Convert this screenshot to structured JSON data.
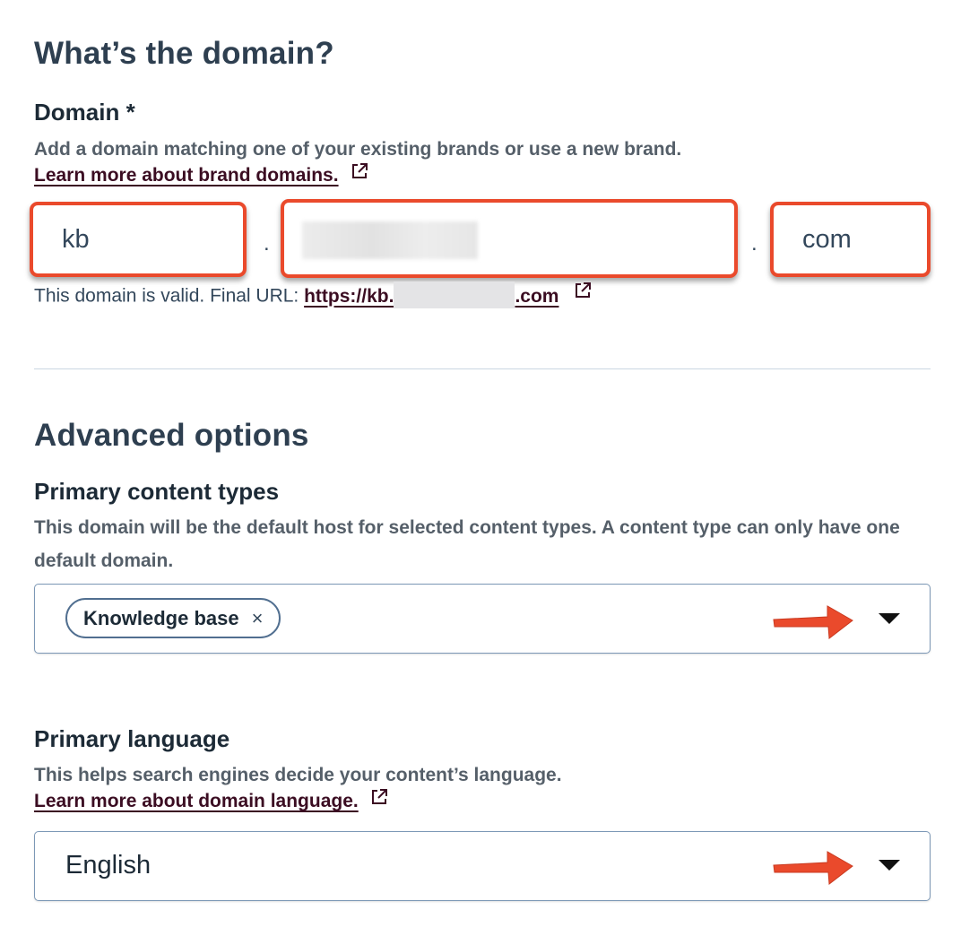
{
  "domain_section": {
    "title": "What’s the domain?",
    "label": "Domain *",
    "help": "Add a domain matching one of your existing brands or use a new brand.",
    "link": "Learn more about brand domains.",
    "subdomain_value": "kb",
    "top_level_value": "com",
    "separator": ".",
    "valid_text": "This domain is valid. Final URL: ",
    "final_url_prefix": "https://kb.",
    "final_url_suffix": ".com"
  },
  "advanced": {
    "title": "Advanced options",
    "content_types": {
      "label": "Primary content types",
      "help": "This domain will be the default host for selected content types. A content type can only have one default domain.",
      "selected_tag": "Knowledge base",
      "remove_glyph": "×"
    },
    "language": {
      "label": "Primary language",
      "help": "This helps search engines decide your content’s language.",
      "link": "Learn more about domain language.",
      "selected": "English"
    }
  },
  "colors": {
    "highlight": "#ea4a2c",
    "link": "#3b0d22",
    "heading": "#2e3f50"
  },
  "icons": [
    "external-link-icon",
    "caret-down-icon",
    "remove-tag-icon",
    "arrow-annotation-icon"
  ]
}
